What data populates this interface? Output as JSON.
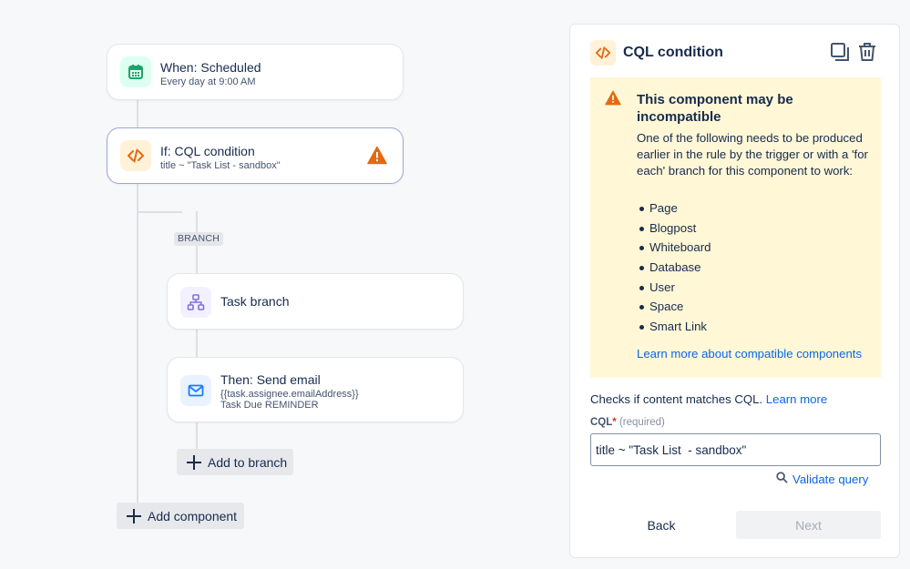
{
  "flow": {
    "trigger": {
      "title": "When: Scheduled",
      "subtitle": "Every day at 9:00 AM",
      "icon": "calendar-icon"
    },
    "condition": {
      "title": "If: CQL condition",
      "subtitle": "title ~ \"Task List - sandbox\"",
      "icon": "code-icon",
      "status_icon": "warning-icon"
    },
    "branch_tag": "BRANCH",
    "branch": {
      "title": "Task branch",
      "icon": "branch-icon"
    },
    "action": {
      "title": "Then: Send email",
      "line1": "{{task.assignee.emailAddress}}",
      "line2": "Task Due REMINDER",
      "icon": "email-icon"
    },
    "add_to_branch_label": "Add to branch",
    "add_component_label": "Add component"
  },
  "panel": {
    "title": "CQL condition",
    "warning": {
      "title": "This component may be incompatible",
      "body": "One of the following needs to be produced earlier in the rule by the trigger or with a 'for each' branch for this component to work:",
      "items": [
        "Page",
        "Blogpost",
        "Whiteboard",
        "Database",
        "User",
        "Space",
        "Smart Link"
      ],
      "link": "Learn more about compatible components"
    },
    "description": "Checks if content matches CQL.",
    "description_link": "Learn more",
    "field": {
      "label": "CQL",
      "required_mark": "*",
      "hint": "(required)",
      "value": "title ~ \"Task List  - sandbox\""
    },
    "validate_label": "Validate query",
    "back_label": "Back",
    "next_label": "Next"
  },
  "colors": {
    "accent": "#0c66e4",
    "warning_bg": "#fff7d6",
    "warning_icon": "#e56910",
    "calendar_green": "#22a06b",
    "code_orange": "#e56910",
    "branch_purple": "#8270db",
    "email_blue": "#1d7afc"
  }
}
